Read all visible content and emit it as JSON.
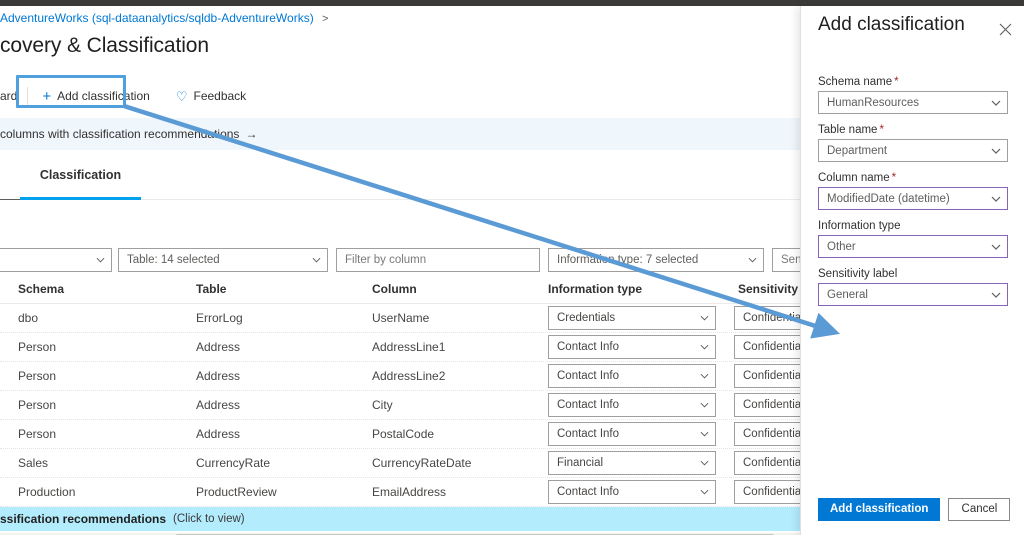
{
  "breadcrumb": {
    "item": "AdventureWorks (sql-dataanalytics/sqldb-AdventureWorks)",
    "separator": ">"
  },
  "page_title": "covery & Classification",
  "toolbar": {
    "discard_label": "ard",
    "add_classification_label": "Add classification",
    "add_icon": "plus-icon",
    "feedback_label": "Feedback",
    "feedback_icon": "heart-icon"
  },
  "info_banner": {
    "text": "columns with classification recommendations",
    "arrow": "→"
  },
  "tabs": [
    {
      "label": "",
      "active": false
    },
    {
      "label": "Classification",
      "active": true
    }
  ],
  "filters": [
    {
      "name": "schema-filter",
      "value": "",
      "has_chevron": true
    },
    {
      "name": "table-filter",
      "value": "Table: 14 selected",
      "has_chevron": true
    },
    {
      "name": "column-filter",
      "value": "Filter by column",
      "has_chevron": false
    },
    {
      "name": "information-type-filter",
      "value": "Information type: 7 selected",
      "has_chevron": true
    },
    {
      "name": "sensitivity-label-filter",
      "value": "Sensit",
      "has_chevron": false
    }
  ],
  "table": {
    "headers": [
      "Schema",
      "Table",
      "Column",
      "Information type",
      "Sensitivity label"
    ],
    "rows": [
      {
        "schema": "dbo",
        "table": "ErrorLog",
        "column": "UserName",
        "information_type": "Credentials",
        "sensitivity_label": "Confidential"
      },
      {
        "schema": "Person",
        "table": "Address",
        "column": "AddressLine1",
        "information_type": "Contact Info",
        "sensitivity_label": "Confidential"
      },
      {
        "schema": "Person",
        "table": "Address",
        "column": "AddressLine2",
        "information_type": "Contact Info",
        "sensitivity_label": "Confidential"
      },
      {
        "schema": "Person",
        "table": "Address",
        "column": "City",
        "information_type": "Contact Info",
        "sensitivity_label": "Confidential"
      },
      {
        "schema": "Person",
        "table": "Address",
        "column": "PostalCode",
        "information_type": "Contact Info",
        "sensitivity_label": "Confidential"
      },
      {
        "schema": "Sales",
        "table": "CurrencyRate",
        "column": "CurrencyRateDate",
        "information_type": "Financial",
        "sensitivity_label": "Confidential"
      },
      {
        "schema": "Production",
        "table": "ProductReview",
        "column": "EmailAddress",
        "information_type": "Contact Info",
        "sensitivity_label": "Confidential"
      }
    ]
  },
  "recommendation_bar": {
    "strong_text": "ssification recommendations",
    "muted_text": "(Click to view)"
  },
  "panel": {
    "title": "Add classification",
    "close_icon": "close-icon",
    "fields": [
      {
        "label": "Schema name",
        "required": true,
        "value": "HumanResources",
        "accent": false
      },
      {
        "label": "Table name",
        "required": true,
        "value": "Department",
        "accent": false
      },
      {
        "label": "Column name",
        "required": true,
        "value": "ModifiedDate (datetime)",
        "accent": true
      },
      {
        "label": "Information type",
        "required": false,
        "value": "Other",
        "accent": true
      },
      {
        "label": "Sensitivity label",
        "required": false,
        "value": "General",
        "accent": true
      }
    ],
    "footer": {
      "primary_label": "Add classification",
      "secondary_label": "Cancel"
    }
  },
  "annotation": {
    "arrow_color": "#5b9bd5",
    "highlight_color": "#50a0dd"
  },
  "colors": {
    "accent": "#0078d4",
    "banner": "#eff6fc",
    "recommendation_bar": "#b3ecfd",
    "tab_active": "#00a2ed",
    "violet_border": "#8764b8",
    "required_asterisk": "#a4262c"
  }
}
